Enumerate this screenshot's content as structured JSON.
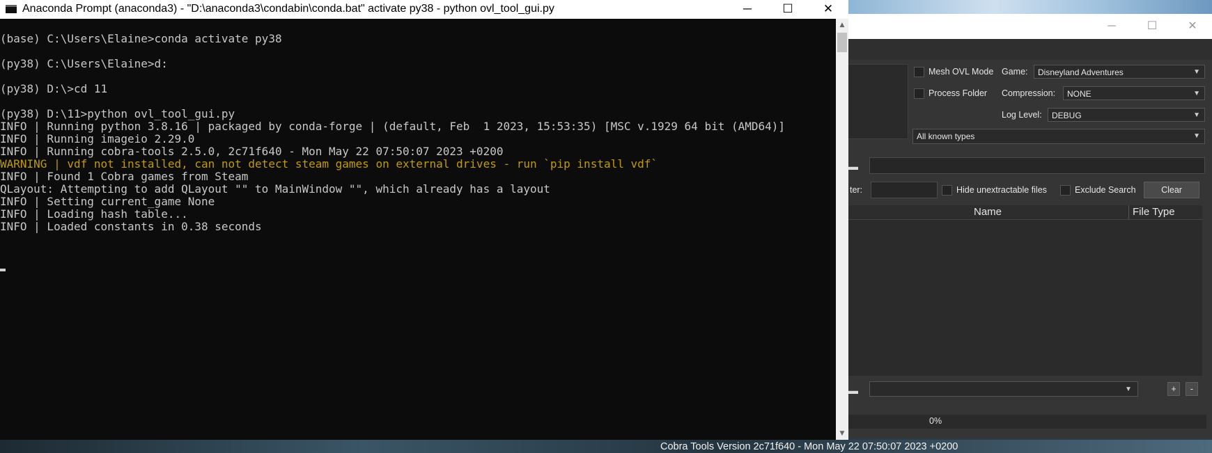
{
  "console": {
    "title": "Anaconda Prompt (anaconda3) - \"D:\\anaconda3\\condabin\\conda.bat\"  activate py38 - python  ovl_tool_gui.py",
    "lines": [
      "(base) C:\\Users\\Elaine>conda activate py38",
      "",
      "(py38) C:\\Users\\Elaine>d:",
      "",
      "(py38) D:\\>cd 11",
      "",
      "(py38) D:\\11>python ovl_tool_gui.py",
      "INFO | Running python 3.8.16 | packaged by conda-forge | (default, Feb  1 2023, 15:53:35) [MSC v.1929 64 bit (AMD64)]",
      "INFO | Running imageio 2.29.0",
      "INFO | Running cobra-tools 2.5.0, 2c71f640 - Mon May 22 07:50:07 2023 +0200",
      "WARNING | vdf not installed, can not detect steam games on external drives - run `pip install vdf`",
      "INFO | Found 1 Cobra games from Steam",
      "QLayout: Attempting to add QLayout \"\" to MainWindow \"\", which already has a layout",
      "INFO | Setting current_game None",
      "INFO | Loading hash table...",
      "INFO | Loaded constants in 0.38 seconds"
    ],
    "warning_color": "#c19c00"
  },
  "gui": {
    "mesh_ovl_mode_label": "Mesh OVL Mode",
    "process_folder_label": "Process Folder",
    "game_label": "Game:",
    "game_value": "Disneyland Adventures",
    "compression_label": "Compression:",
    "compression_value": "NONE",
    "log_level_label": "Log Level:",
    "log_level_value": "DEBUG",
    "type_filter_value": "All known types",
    "filter_label_partial": "ter:",
    "hide_unextractable_label": "Hide unextractable files",
    "exclude_search_label": "Exclude Search",
    "clear_button": "Clear",
    "columns": [
      "Name",
      "File Type"
    ],
    "add_button": "+",
    "remove_button": "-",
    "progress_text": "0%",
    "progress_value": 0,
    "status_text": "Cobra Tools Version 2c71f640 - Mon May 22 07:50:07 2023 +0200"
  }
}
